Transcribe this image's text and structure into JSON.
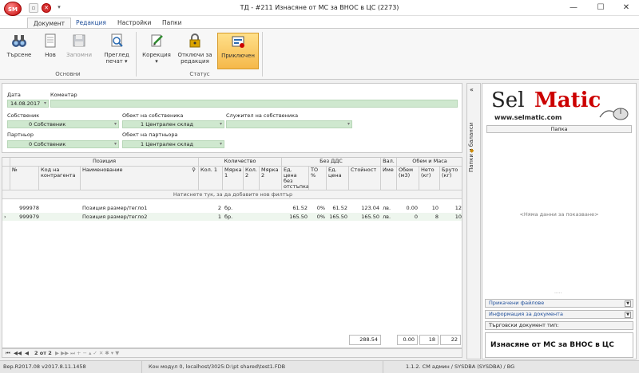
{
  "window": {
    "title": "ТД - #211 Изнасяне от МС за ВНОС в ЦС (2273)",
    "app_logo": "SM"
  },
  "tabs": [
    "Документ",
    "Редакция",
    "Настройки",
    "Папки"
  ],
  "ribbon": {
    "buttons": {
      "search": "Търсене",
      "new": "Нов",
      "save": "Запомни",
      "preview": "Преглед печат",
      "correction": "Корекция",
      "unlock": "Отключи за редакция",
      "closed": "Приключен"
    },
    "groups": {
      "basic": "Основни",
      "status": "Статус"
    }
  },
  "form": {
    "date_label": "Дата",
    "date_value": "14.08.2017",
    "comment_label": "Коментар",
    "owner_label": "Собственик",
    "owner_value": "0 Собственик",
    "owner_obj_label": "Обект на собственика",
    "owner_obj_value": "1 Централен склад",
    "employee_label": "Служител на собственика",
    "partner_label": "Партньор",
    "partner_value": "0 Собственик",
    "partner_obj_label": "Обект на партньора",
    "partner_obj_value": "1 Централен склад"
  },
  "grid": {
    "bands": {
      "position": "Позиция",
      "quantity": "Количество",
      "novat": "Без ДДС",
      "currency": "Вал.",
      "volume": "Обем и Маса"
    },
    "headers": {
      "no": "№",
      "code": "Код на контрагента",
      "name": "Наименование",
      "qty1": "Кол. 1",
      "unit1": "Мярка 1",
      "qty2": "Кол. 2",
      "unit2": "Мярка 2",
      "price": "Ед. цена без отстъпка",
      "discount": "ТО %",
      "unitprice": "Ед. цена",
      "value": "Стойност",
      "curname": "Име",
      "volume": "Обем (м3)",
      "net": "Нето (кг)",
      "gross": "Бруто (кг)"
    },
    "filter_hint": "Натиснете тук, за да добавите нов филтър",
    "rows": [
      {
        "no": "999978",
        "name": "Позиция размер/тегло1",
        "qty1": "2",
        "unit1": "бр.",
        "price": "61.52",
        "discount": "0%",
        "unitprice": "61.52",
        "value": "123.04",
        "cur": "лв.",
        "volume": "0.00",
        "net": "10",
        "gross": "12"
      },
      {
        "no": "999979",
        "name": "Позиция размер/тегло2",
        "qty1": "1",
        "unit1": "бр.",
        "price": "165.50",
        "discount": "0%",
        "unitprice": "165.50",
        "value": "165.50",
        "cur": "лв.",
        "volume": "0",
        "net": "8",
        "gross": "10"
      }
    ],
    "totals": {
      "value": "288.54",
      "volume": "0.00",
      "net": "18",
      "gross": "22"
    },
    "nav_record": "2 от 2"
  },
  "right": {
    "vtab": "Папки и баланси",
    "logo_sel": "Sel",
    "logo_matic": "Matic",
    "logo_url": "www.selmatic.com",
    "folder_header": "Папка",
    "no_data": "<Няма данни за показване>",
    "attached_files": "Прикачени файлове",
    "doc_info": "Информация за документа",
    "doc_type_label": "Търговски документ тип:",
    "doc_type_value": "Изнасяне от МС за ВНОС в ЦС"
  },
  "status": {
    "version": "Вер.R2017.08 v2017.8.11.1458",
    "connection": "Кон модул 0, localhost/3025:D:\\pt shared\\test1.FDB",
    "user": "1.1.2. СМ админ / SYSDBA (SYSDBA) / BG"
  }
}
